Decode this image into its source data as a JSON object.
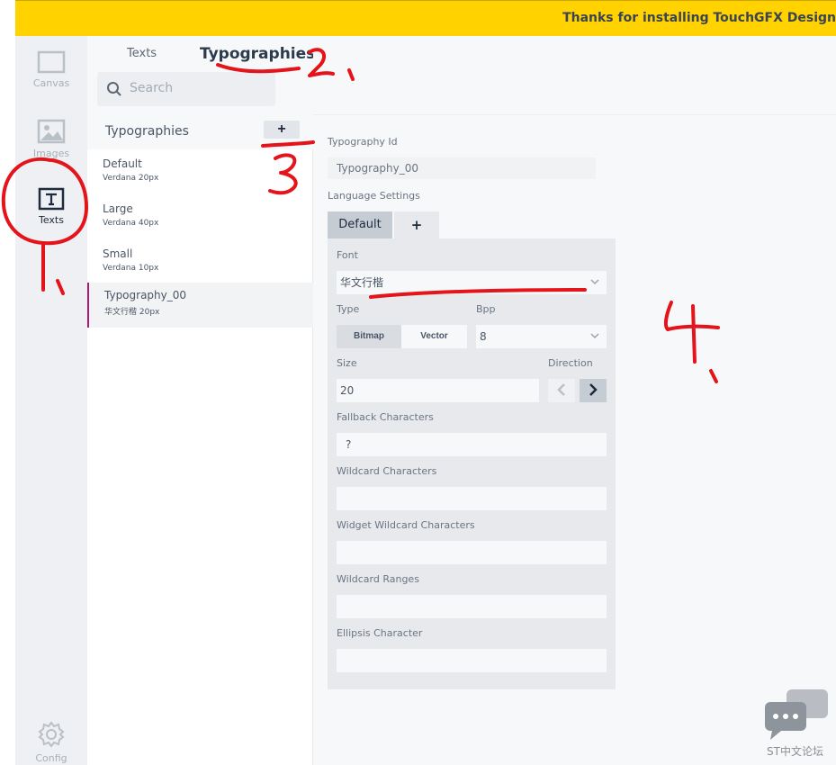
{
  "banner": {
    "text": "Thanks for installing TouchGFX Design"
  },
  "rail": {
    "canvas_label": "Canvas",
    "images_label": "Images",
    "texts_label": "Texts",
    "config_label": "Config"
  },
  "panel": {
    "tabs": [
      {
        "label": "Texts",
        "active": false
      },
      {
        "label": "Typographies",
        "active": true
      }
    ],
    "search_placeholder": "Search",
    "list_title": "Typographies",
    "add_label": "+",
    "items": [
      {
        "name": "Default",
        "sub": "Verdana 20px"
      },
      {
        "name": "Large",
        "sub": "Verdana 40px"
      },
      {
        "name": "Small",
        "sub": "Verdana 10px"
      },
      {
        "name": "Typography_00",
        "sub": "华文行楷 20px"
      }
    ]
  },
  "details": {
    "typography_id_label": "Typography Id",
    "typography_id_value": "Typography_00",
    "language_settings_label": "Language Settings",
    "lang_tabs": [
      {
        "label": "Default"
      },
      {
        "label": "+"
      }
    ],
    "font_label": "Font",
    "font_value": "华文行楷",
    "type_label": "Type",
    "type_options": [
      "Bitmap",
      "Vector"
    ],
    "bpp_label": "Bpp",
    "bpp_value": "8",
    "size_label": "Size",
    "size_value": "20",
    "direction_label": "Direction",
    "fallback_label": "Fallback Characters",
    "fallback_value": "?",
    "wildcard_label": "Wildcard Characters",
    "widget_wildcard_label": "Widget Wildcard Characters",
    "wildcard_ranges_label": "Wildcard Ranges",
    "ellipsis_label": "Ellipsis Character"
  },
  "watermark": {
    "text": "ST中文论坛"
  },
  "colors": {
    "banner": "#ffd200",
    "accent": "#b0176f",
    "annotation": "#e4141b",
    "rail_bg": "#eef0f3"
  }
}
